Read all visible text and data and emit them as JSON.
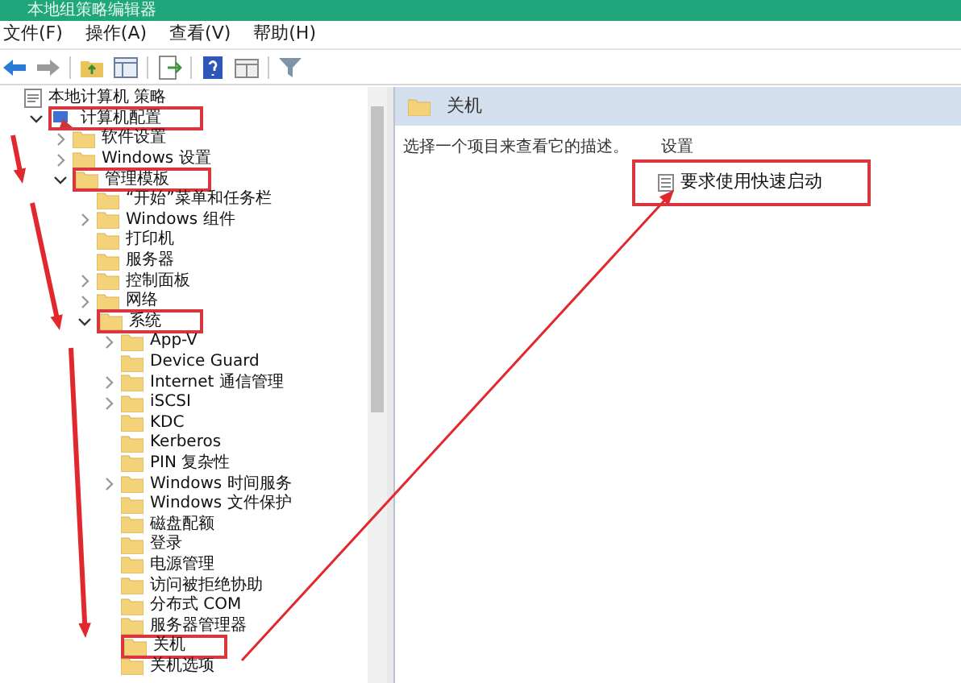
{
  "window": {
    "title": "本地组策略编辑器"
  },
  "menu": [
    "文件(F)",
    "操作(A)",
    "查看(V)",
    "帮助(H)"
  ],
  "tree": [
    {
      "label": "本地计算机 策略",
      "kind": "policy",
      "expandable": false,
      "highlighted": false,
      "children": [
        {
          "label": "计算机配置",
          "kind": "computer",
          "expandable": true,
          "expanded": true,
          "highlighted": true,
          "children": [
            {
              "label": "软件设置",
              "kind": "folder",
              "expandable": true,
              "expanded": false,
              "highlighted": false
            },
            {
              "label": "Windows 设置",
              "kind": "folder",
              "expandable": true,
              "expanded": false,
              "highlighted": false
            },
            {
              "label": "管理模板",
              "kind": "folder",
              "expandable": true,
              "expanded": true,
              "highlighted": true,
              "children": [
                {
                  "label": "“开始”菜单和任务栏",
                  "kind": "folder",
                  "expandable": false,
                  "highlighted": false
                },
                {
                  "label": "Windows 组件",
                  "kind": "folder",
                  "expandable": true,
                  "expanded": false,
                  "highlighted": false
                },
                {
                  "label": "打印机",
                  "kind": "folder",
                  "expandable": false,
                  "highlighted": false
                },
                {
                  "label": "服务器",
                  "kind": "folder",
                  "expandable": false,
                  "highlighted": false
                },
                {
                  "label": "控制面板",
                  "kind": "folder",
                  "expandable": true,
                  "expanded": false,
                  "highlighted": false
                },
                {
                  "label": "网络",
                  "kind": "folder",
                  "expandable": true,
                  "expanded": false,
                  "highlighted": false
                },
                {
                  "label": "系统",
                  "kind": "folder",
                  "expandable": true,
                  "expanded": true,
                  "highlighted": true,
                  "children": [
                    {
                      "label": "App-V",
                      "kind": "folder",
                      "expandable": true,
                      "expanded": false,
                      "highlighted": false
                    },
                    {
                      "label": "Device Guard",
                      "kind": "folder",
                      "expandable": false,
                      "highlighted": false
                    },
                    {
                      "label": "Internet 通信管理",
                      "kind": "folder",
                      "expandable": true,
                      "expanded": false,
                      "highlighted": false
                    },
                    {
                      "label": "iSCSI",
                      "kind": "folder",
                      "expandable": true,
                      "expanded": false,
                      "highlighted": false
                    },
                    {
                      "label": "KDC",
                      "kind": "folder",
                      "expandable": false,
                      "highlighted": false
                    },
                    {
                      "label": "Kerberos",
                      "kind": "folder",
                      "expandable": false,
                      "highlighted": false
                    },
                    {
                      "label": "PIN 复杂性",
                      "kind": "folder",
                      "expandable": false,
                      "highlighted": false
                    },
                    {
                      "label": "Windows 时间服务",
                      "kind": "folder",
                      "expandable": true,
                      "expanded": false,
                      "highlighted": false
                    },
                    {
                      "label": "Windows 文件保护",
                      "kind": "folder",
                      "expandable": false,
                      "highlighted": false
                    },
                    {
                      "label": "磁盘配额",
                      "kind": "folder",
                      "expandable": false,
                      "highlighted": false
                    },
                    {
                      "label": "登录",
                      "kind": "folder",
                      "expandable": false,
                      "highlighted": false
                    },
                    {
                      "label": "电源管理",
                      "kind": "folder",
                      "expandable": false,
                      "highlighted": false
                    },
                    {
                      "label": "访问被拒绝协助",
                      "kind": "folder",
                      "expandable": false,
                      "highlighted": false
                    },
                    {
                      "label": "分布式 COM",
                      "kind": "folder",
                      "expandable": false,
                      "highlighted": false
                    },
                    {
                      "label": "服务器管理器",
                      "kind": "folder",
                      "expandable": false,
                      "highlighted": false
                    },
                    {
                      "label": "关机",
                      "kind": "folder",
                      "expandable": false,
                      "highlighted": true
                    },
                    {
                      "label": "关机选项",
                      "kind": "folder",
                      "expandable": false,
                      "highlighted": false
                    }
                  ]
                }
              ]
            }
          ]
        }
      ]
    }
  ],
  "details": {
    "header": "关机",
    "description": "选择一个项目来查看它的描述。",
    "column_header": "设置",
    "settings": [
      {
        "label": "要求使用快速启动",
        "highlighted": true
      }
    ]
  }
}
